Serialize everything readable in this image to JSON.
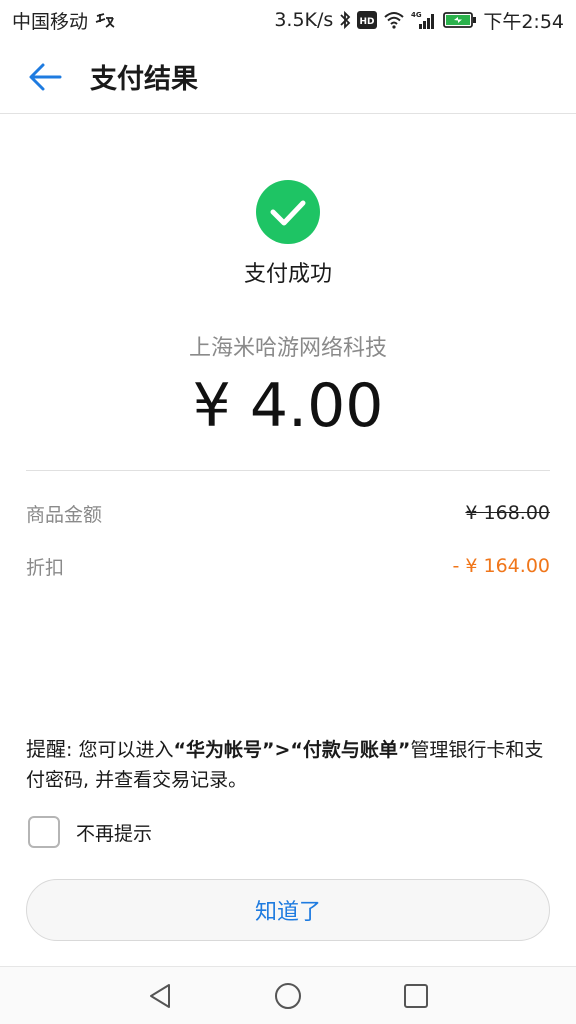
{
  "status_bar": {
    "carrier": "中国移动",
    "carrier_icon": "sim-icon",
    "net_speed": "3.5K/s",
    "network_type": "4G",
    "hd_badge": "HD",
    "time": "下午2:54"
  },
  "header": {
    "title": "支付结果",
    "back_icon": "arrow-left-icon"
  },
  "result": {
    "status": "支付成功",
    "merchant": "上海米哈游网络科技",
    "amount": "¥ 4.00",
    "icon_color": "#1ec464"
  },
  "details": [
    {
      "label": "商品金额",
      "value": "¥ 168.00"
    },
    {
      "label": "折扣",
      "value": "- ¥ 164.00"
    }
  ],
  "reminder": {
    "lead": "提醒",
    "text_1": ": 您可以进入",
    "link_1": "“华为帐号”",
    "sep": ">",
    "link_2": "“付款与账单”",
    "text_2": "管理银行卡和支付密码, 并查看交易记录。"
  },
  "checkbox": {
    "label": "不再提示",
    "checked": false
  },
  "ok_button": {
    "label": "知道了"
  },
  "colors": {
    "accent": "#1e7be0",
    "success": "#1ec464",
    "discount": "#f0761a"
  }
}
